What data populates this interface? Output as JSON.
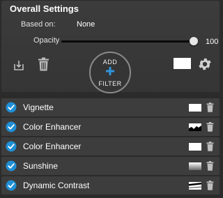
{
  "overall": {
    "title": "Overall Settings",
    "based_on_label": "Based on:",
    "based_on_value": "None",
    "opacity_label": "Opacity",
    "opacity_value": "100",
    "opacity_fraction": 1.0
  },
  "add_filter": {
    "line1": "ADD",
    "line2": "FILTER"
  },
  "colors": {
    "accent_check": "#1f8fd6",
    "panel_bg": "#3a3a3a",
    "row_bg": "#3d3d3d"
  },
  "filters": [
    {
      "name": "Vignette",
      "mask": "white",
      "enabled": true
    },
    {
      "name": "Color Enhancer",
      "mask": "mountain",
      "enabled": true
    },
    {
      "name": "Color Enhancer",
      "mask": "white",
      "enabled": true
    },
    {
      "name": "Sunshine",
      "mask": "gradient",
      "enabled": true
    },
    {
      "name": "Dynamic Contrast",
      "mask": "streak",
      "enabled": true
    }
  ]
}
